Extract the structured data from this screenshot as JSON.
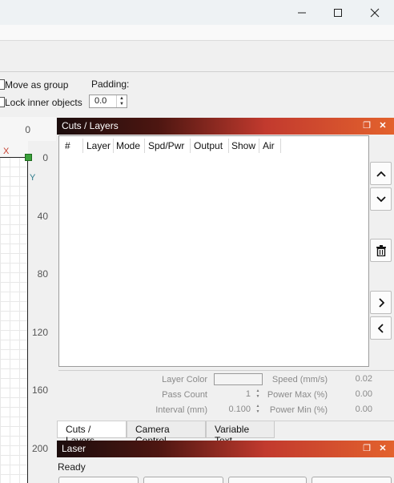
{
  "window": {
    "controls": {
      "minimize": "minimize-icon",
      "maximize": "maximize-icon",
      "close": "close-icon"
    }
  },
  "options": {
    "move_as_group": "Move as group",
    "lock_inner_objects": "Lock inner objects",
    "padding_label": "Padding:",
    "padding_value": "0.0"
  },
  "ruler": {
    "top_value": "0",
    "axis_x": "X",
    "axis_y": "Y",
    "marks": [
      "0",
      "40",
      "80",
      "120",
      "160",
      "200"
    ]
  },
  "cuts_panel": {
    "title": "Cuts / Layers",
    "columns": [
      "#",
      "Layer",
      "Mode",
      "Spd/Pwr",
      "Output",
      "Show",
      "Air"
    ],
    "rows": [],
    "side_buttons": [
      "move-up-icon",
      "move-down-icon",
      "delete-icon",
      "arrow-right-icon",
      "arrow-left-icon"
    ],
    "properties": {
      "layer_color_label": "Layer Color",
      "pass_count_label": "Pass Count",
      "pass_count_value": "1",
      "interval_label": "Interval (mm)",
      "interval_value": "0.100",
      "speed_label": "Speed (mm/s)",
      "speed_value": "0.02",
      "power_max_label": "Power Max (%)",
      "power_max_value": "0.00",
      "power_min_label": "Power Min (%)",
      "power_min_value": "0.00"
    },
    "tabs": [
      "Cuts / Layers",
      "Camera Control",
      "Variable Text"
    ],
    "active_tab": "Cuts / Layers"
  },
  "laser_panel": {
    "title": "Laser",
    "status": "Ready"
  },
  "colors": {
    "accent_gradient_start": "#1b0d0d",
    "accent_gradient_end": "#e3622d",
    "origin_marker": "#3aa03a"
  }
}
